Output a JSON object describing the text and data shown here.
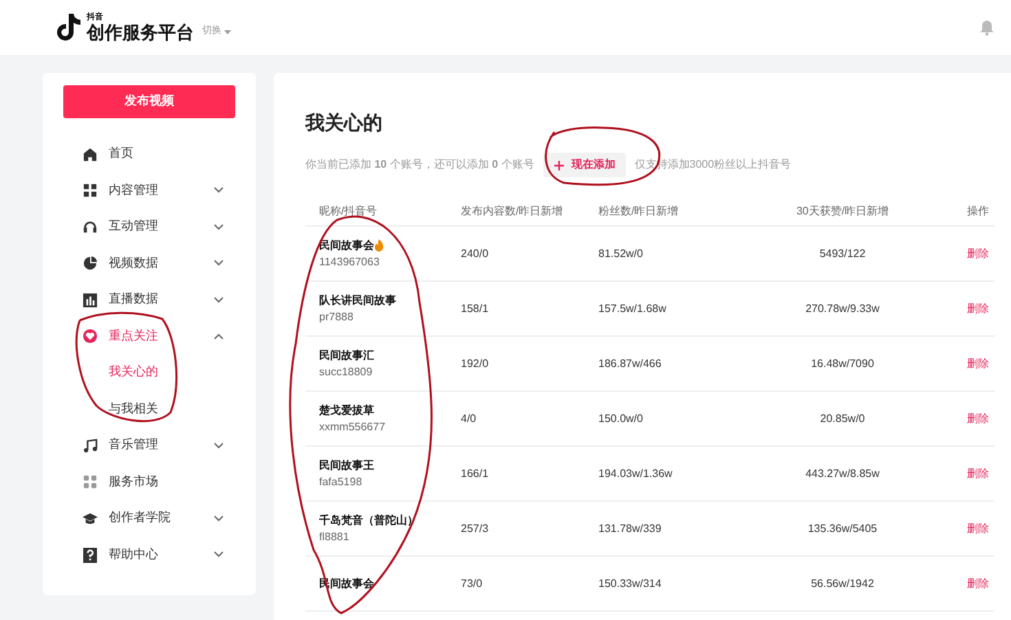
{
  "header": {
    "logo_small": "抖音",
    "logo_title": "创作服务平台",
    "switcher": "切换"
  },
  "sidebar": {
    "publish_button": "发布视频",
    "items": [
      {
        "label": "首页",
        "selected": false
      },
      {
        "label": "内容管理",
        "selected": false,
        "expanded": false
      },
      {
        "label": "互动管理",
        "selected": false,
        "expanded": false
      },
      {
        "label": "视频数据",
        "selected": false,
        "expanded": false
      },
      {
        "label": "直播数据",
        "selected": false,
        "expanded": false
      },
      {
        "label": "重点关注",
        "selected": true,
        "expanded": true,
        "children": [
          {
            "label": "我关心的",
            "selected": true
          },
          {
            "label": "与我相关",
            "selected": false
          }
        ]
      },
      {
        "label": "音乐管理",
        "selected": false,
        "expanded": false
      },
      {
        "label": "服务市场",
        "selected": false
      },
      {
        "label": "创作者学院",
        "selected": false,
        "expanded": false
      },
      {
        "label": "帮助中心",
        "selected": false,
        "expanded": false
      }
    ]
  },
  "main": {
    "title": "我关心的",
    "summary": "你当前已添加 **10** 个账号，还可以添加 **0** 个账号",
    "add_button": "现在添加",
    "note": "仅支持添加3000粉丝以上抖音号",
    "table": {
      "columns": [
        "昵称/抖音号",
        "发布内容数/昨日新增",
        "粉丝数/昨日新增",
        "30天获赞/昨日新增",
        "操作"
      ],
      "rows": [
        {
          "name": "民间故事会",
          "fire": true,
          "id": "1143967063",
          "posts": "240/0",
          "fans": "81.52w/0",
          "likes": "5493/122",
          "action": "删除"
        },
        {
          "name": "队长讲民间故事",
          "fire": false,
          "id": "pr7888",
          "posts": "158/1",
          "fans": "157.5w/1.68w",
          "likes": "270.78w/9.33w",
          "action": "删除"
        },
        {
          "name": "民间故事汇",
          "fire": false,
          "id": "succ18809",
          "posts": "192/0",
          "fans": "186.87w/466",
          "likes": "16.48w/7090",
          "action": "删除"
        },
        {
          "name": "楚戈爱拔草",
          "fire": false,
          "id": "xxmm556677",
          "posts": "4/0",
          "fans": "150.0w/0",
          "likes": "20.85w/0",
          "action": "删除"
        },
        {
          "name": "民间故事王",
          "fire": false,
          "id": "fafa5198",
          "posts": "166/1",
          "fans": "194.03w/1.36w",
          "likes": "443.27w/8.85w",
          "action": "删除"
        },
        {
          "name": "千岛梵音（普陀山）",
          "fire": false,
          "id": "fl8881",
          "posts": "257/3",
          "fans": "131.78w/339",
          "likes": "135.36w/5405",
          "action": "删除"
        },
        {
          "name": "民间故事会",
          "fire": false,
          "id": "",
          "posts": "73/0",
          "fans": "150.33w/314",
          "likes": "56.56w/1942",
          "action": "删除"
        }
      ]
    }
  }
}
